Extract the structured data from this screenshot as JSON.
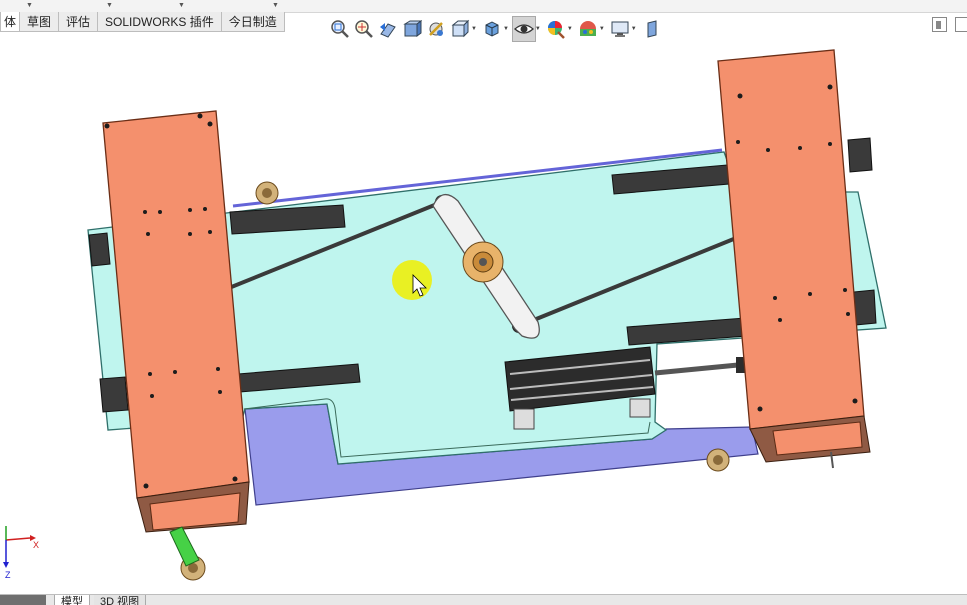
{
  "command_tabs": [
    {
      "label": "体",
      "active": true
    },
    {
      "label": "草图",
      "active": false
    },
    {
      "label": "评估",
      "active": false
    },
    {
      "label": "SOLIDWORKS 插件",
      "active": false
    },
    {
      "label": "今日制造",
      "active": false
    }
  ],
  "view_toolbar": [
    {
      "icon": "zoom-to-fit-icon",
      "dropdown": false,
      "selected": false
    },
    {
      "icon": "zoom-to-area-icon",
      "dropdown": false,
      "selected": false
    },
    {
      "icon": "previous-view-icon",
      "dropdown": false,
      "selected": false
    },
    {
      "icon": "section-view-icon",
      "dropdown": false,
      "selected": false
    },
    {
      "icon": "dynamic-annotation-icon",
      "dropdown": false,
      "selected": false
    },
    {
      "icon": "view-orientation-icon",
      "dropdown": true,
      "selected": false
    },
    {
      "icon": "display-style-icon",
      "dropdown": true,
      "selected": false
    },
    {
      "icon": "hide-show-items-icon",
      "dropdown": true,
      "selected": true
    },
    {
      "icon": "edit-appearance-icon",
      "dropdown": true,
      "selected": false
    },
    {
      "icon": "apply-scene-icon",
      "dropdown": true,
      "selected": false
    },
    {
      "icon": "view-settings-icon",
      "dropdown": true,
      "selected": false
    },
    {
      "icon": "task-pane-icon",
      "dropdown": false,
      "selected": false
    }
  ],
  "colors": {
    "base_plate": "#bff5ee",
    "side_block": "#f4906d",
    "lower_block": "#9a9cec",
    "rail": "#3a3a3a",
    "cursor_highlight": "#e9f023"
  },
  "bottom_tabs": [
    {
      "label": "",
      "active": false
    },
    {
      "label": "模型",
      "active": true
    },
    {
      "label": "3D 视图",
      "active": false
    }
  ],
  "triad": {
    "x_label": "X",
    "z_label": "Z"
  }
}
